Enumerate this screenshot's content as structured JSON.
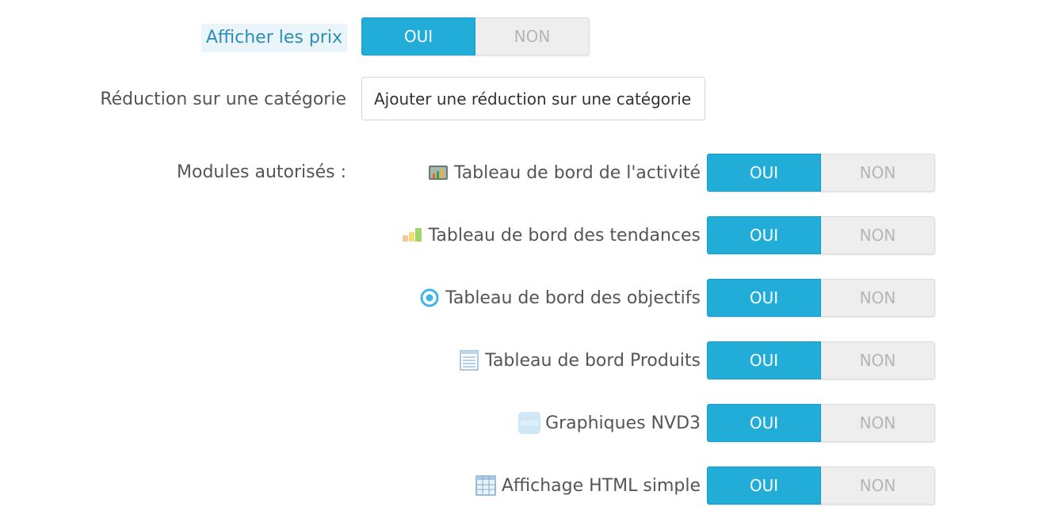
{
  "show_prices": {
    "label": "Afficher les prix",
    "yes": "OUI",
    "no": "NON",
    "selected": "OUI"
  },
  "category_discount": {
    "label": "Réduction sur une catégorie",
    "button": "Ajouter une réduction sur une catégorie"
  },
  "modules": {
    "label": "Modules autorisés :",
    "items": [
      {
        "name": "Tableau de bord de l'activité",
        "icon": "activity-dashboard-icon",
        "yes": "OUI",
        "no": "NON",
        "selected": "OUI"
      },
      {
        "name": "Tableau de bord des tendances",
        "icon": "trends-dashboard-icon",
        "yes": "OUI",
        "no": "NON",
        "selected": "OUI"
      },
      {
        "name": "Tableau de bord des objectifs",
        "icon": "goals-target-icon",
        "yes": "OUI",
        "no": "NON",
        "selected": "OUI"
      },
      {
        "name": "Tableau de bord Produits",
        "icon": "products-list-icon",
        "yes": "OUI",
        "no": "NON",
        "selected": "OUI"
      },
      {
        "name": "Graphiques NVD3",
        "icon": "nvd3-icon",
        "icon_text": "NVD3",
        "yes": "OUI",
        "no": "NON",
        "selected": "OUI"
      },
      {
        "name": "Affichage HTML simple",
        "icon": "table-grid-icon",
        "yes": "OUI",
        "no": "NON",
        "selected": "OUI"
      }
    ]
  },
  "colors": {
    "accent": "#22acd8",
    "off_bg": "#eeeeee",
    "off_text": "#b5b5b5",
    "highlight_label": "#2e8eb6"
  }
}
